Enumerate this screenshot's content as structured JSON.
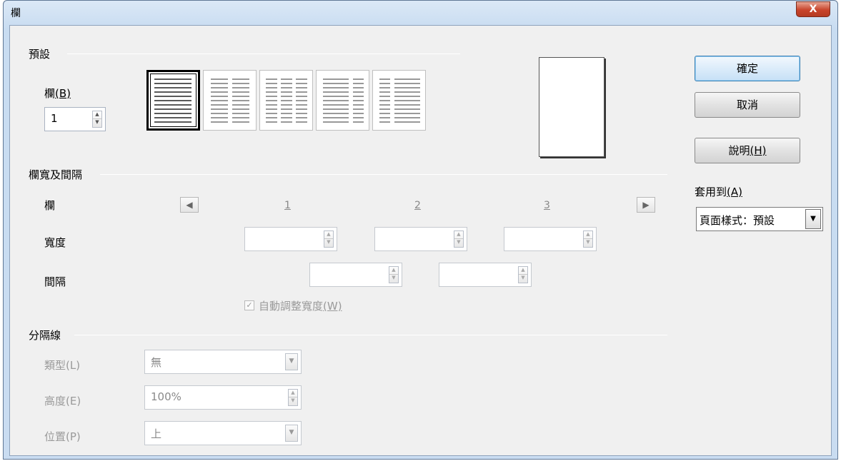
{
  "window": {
    "title": "欄",
    "close_label": "X"
  },
  "presets_section": {
    "label": "預設",
    "columns_label_text": "欄",
    "columns_label_key": "(B)",
    "columns_value": "1",
    "presets": [
      "1-column",
      "2-columns",
      "3-columns",
      "2-columns-left-wide",
      "2-columns-right-wide"
    ],
    "selected_preset": 0
  },
  "width_spacing_section": {
    "label": "欄寬及間隔",
    "column_row_label": "欄",
    "width_row_label": "寬度",
    "spacing_row_label": "間隔",
    "column_numbers": [
      "1",
      "2",
      "3"
    ],
    "width_values": [
      "",
      "",
      ""
    ],
    "spacing_values": [
      "",
      ""
    ],
    "autowidth_label_text": "自動調整寬度",
    "autowidth_label_key": "(W)",
    "autowidth_checked": true,
    "prev_icon": "left-arrow-icon",
    "next_icon": "right-arrow-icon"
  },
  "separator_section": {
    "label": "分隔線",
    "type_label": "類型(L)",
    "type_value": "無",
    "height_label": "高度(E)",
    "height_value": "100%",
    "position_label": "位置(P)",
    "position_value": "上"
  },
  "buttons": {
    "ok": "確定",
    "cancel": "取消",
    "help_text": "說明",
    "help_key": "(H)"
  },
  "apply_to": {
    "label_text": "套用到",
    "label_key": "(A)",
    "value": "頁面樣式：預設"
  }
}
